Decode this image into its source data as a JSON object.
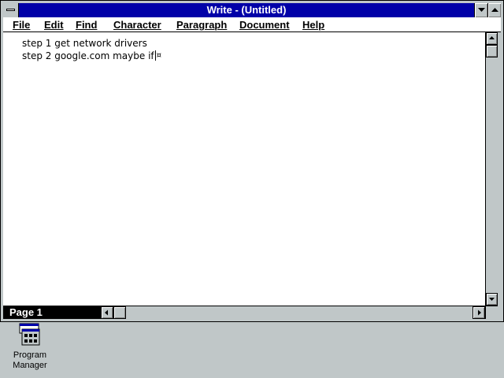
{
  "window": {
    "title": "Write - (Untitled)"
  },
  "menu": {
    "items": [
      {
        "label": "File"
      },
      {
        "label": "Edit"
      },
      {
        "label": "Find"
      },
      {
        "label": "Character"
      },
      {
        "label": "Paragraph"
      },
      {
        "label": "Document"
      },
      {
        "label": "Help"
      }
    ]
  },
  "document": {
    "lines": [
      "step 1 get network drivers",
      "step 2 google.com maybe if"
    ],
    "end_mark": "¤"
  },
  "status": {
    "page": "Page 1"
  },
  "desktop": {
    "icons": [
      {
        "label": "Program Manager",
        "icon": "program-manager-icon"
      }
    ]
  },
  "colors": {
    "title_bar": "#0000a8",
    "desktop": "#c0c7c8"
  }
}
